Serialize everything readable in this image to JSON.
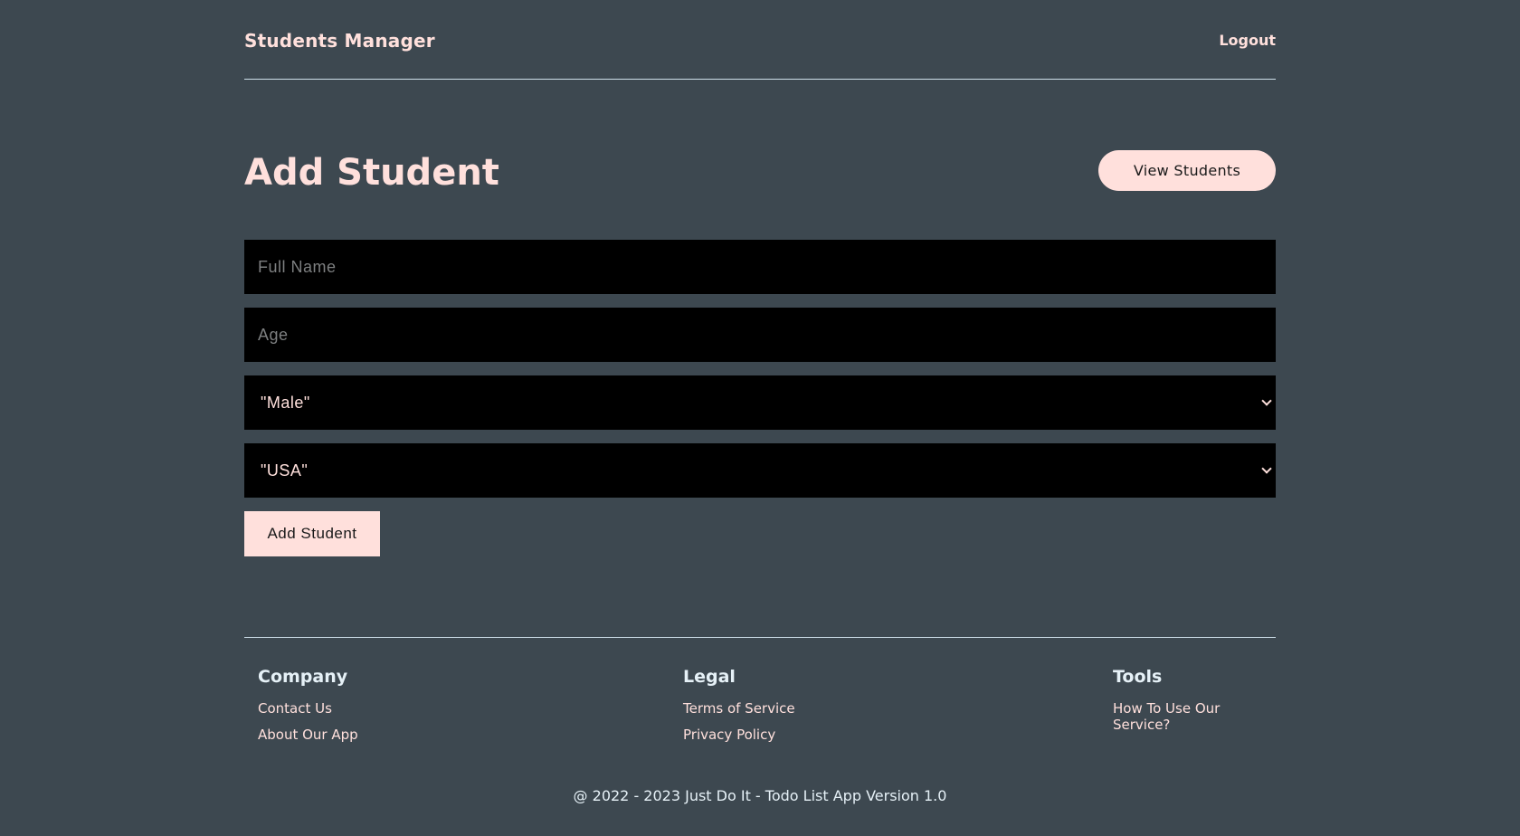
{
  "header": {
    "brand": "Students Manager",
    "logout_label": "Logout"
  },
  "page": {
    "title": "Add Student",
    "view_students_label": "View Students"
  },
  "form": {
    "full_name_placeholder": "Full Name",
    "full_name_value": "",
    "age_placeholder": "Age",
    "age_value": "",
    "gender_selected": "\"Male\"",
    "country_selected": "\"USA\"",
    "submit_label": "Add Student"
  },
  "footer": {
    "company": {
      "heading": "Company",
      "links": [
        "Contact Us",
        "About Our App"
      ]
    },
    "legal": {
      "heading": "Legal",
      "links": [
        "Terms of Service",
        "Privacy Policy"
      ]
    },
    "tools": {
      "heading": "Tools",
      "links": [
        "How To Use Our Service?"
      ]
    },
    "copyright": "@ 2022 - 2023 Just Do It - Todo List App Version 1.0"
  },
  "colors": {
    "background": "#3d4850",
    "accent": "#ffe0dc",
    "field_background": "#000000"
  }
}
